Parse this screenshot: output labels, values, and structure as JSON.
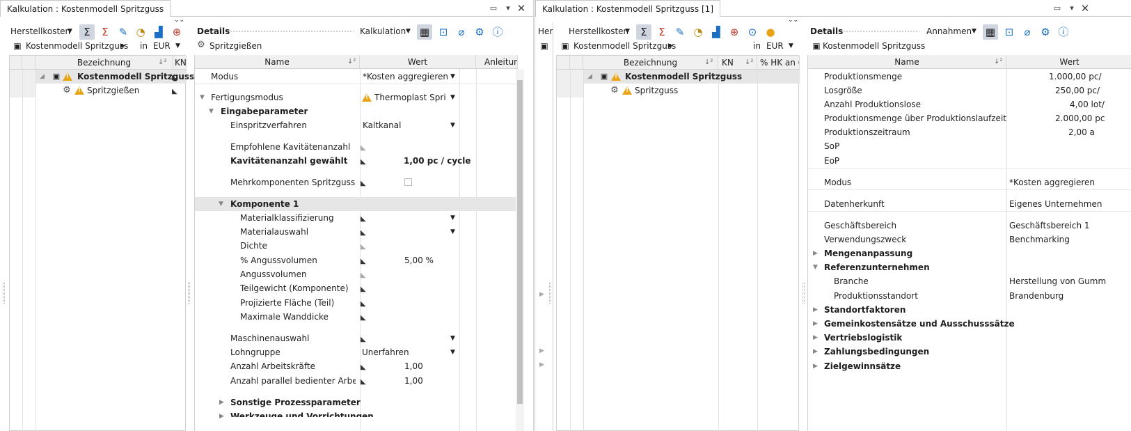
{
  "left_window": {
    "title": "Kalkulation : Kostenmodell Spritzguss",
    "toolbar": {
      "cost_select": "Herstellkosten",
      "breadcrumb": "Kostenmodell Spritzguss",
      "in_label": "in",
      "currency": "EUR"
    },
    "tree": {
      "columns": [
        "Bezeichnung",
        "KN"
      ],
      "rows": [
        {
          "label": "Kostenmodell Spritzguss"
        },
        {
          "label": "Spritzgießen"
        }
      ]
    },
    "details": {
      "title": "Details",
      "mode": "Kalkulation",
      "subtitle": "Spritzgießen",
      "columns": {
        "name": "Name",
        "value": "Wert",
        "guide": "Anleitung"
      },
      "rows": [
        {
          "name": "Modus",
          "value": "*Kosten aggregieren"
        },
        {
          "name": "Fertigungsmodus",
          "value": "Thermoplast Sprit..."
        },
        {
          "name": "Eingabeparameter",
          "value": ""
        },
        {
          "name": "Einspritzverfahren",
          "value": "Kaltkanal"
        },
        {
          "name": "Empfohlene Kavitätenanzahl",
          "value": ""
        },
        {
          "name": "Kavitätenanzahl gewählt",
          "value": "1,00 pc / cycle"
        },
        {
          "name": "Mehrkomponenten Spritzguss",
          "value": ""
        },
        {
          "name": "Komponente 1",
          "value": ""
        },
        {
          "name": "Materialklassifizierung",
          "value": ""
        },
        {
          "name": "Materialauswahl",
          "value": ""
        },
        {
          "name": "Dichte",
          "value": ""
        },
        {
          "name": "% Angussvolumen",
          "value": "5,00 %"
        },
        {
          "name": "Angussvolumen",
          "value": ""
        },
        {
          "name": "Teilgewicht (Komponente)",
          "value": ""
        },
        {
          "name": "Projizierte Fläche (Teil)",
          "value": ""
        },
        {
          "name": "Maximale Wanddicke",
          "value": ""
        },
        {
          "name": "Maschinenauswahl",
          "value": ""
        },
        {
          "name": "Lohngruppe",
          "value": "Unerfahren"
        },
        {
          "name": "Anzahl Arbeitskräfte",
          "value": "1,00"
        },
        {
          "name": "Anzahl parallel bedienter Arbeits...",
          "value": "1,00"
        },
        {
          "name": "Sonstige Prozessparameter",
          "value": ""
        },
        {
          "name": "Werkzeuge und Vorrichtungen",
          "value": ""
        }
      ]
    }
  },
  "right_window": {
    "title": "Kalkulation : Kostenmodell Spritzguss [1]",
    "toolbar": {
      "cut_label": "Her",
      "cost_select": "Herstellkosten",
      "breadcrumb": "Kostenmodell Spritzguss",
      "in_label": "in",
      "currency": "EUR"
    },
    "tree": {
      "columns": [
        "Bezeichnung",
        "KN",
        "% HK an G"
      ],
      "rows": [
        {
          "label": "Kostenmodell Spritzguss"
        },
        {
          "label": "Spritzguss"
        }
      ]
    },
    "details": {
      "title": "Details",
      "mode": "Annahmen",
      "subtitle": "Kostenmodell Spritzguss",
      "columns": {
        "name": "Name",
        "value": "Wert"
      },
      "rows": [
        {
          "name": "Produktionsmenge",
          "value": "1.000,00 pc/"
        },
        {
          "name": "Losgröße",
          "value": "250,00 pc/"
        },
        {
          "name": "Anzahl Produktionslose",
          "value": "4,00 lot/"
        },
        {
          "name": "Produktionsmenge über Produktionslaufzeit",
          "value": "2.000,00 pc"
        },
        {
          "name": "Produktionszeitraum",
          "value": "2,00 a"
        },
        {
          "name": "SoP",
          "value": ""
        },
        {
          "name": "EoP",
          "value": ""
        },
        {
          "name": "Modus",
          "value": "*Kosten aggregieren"
        },
        {
          "name": "Datenherkunft",
          "value": "Eigenes Unternehmen"
        },
        {
          "name": "Geschäftsbereich",
          "value": "Geschäftsbereich 1"
        },
        {
          "name": "Verwendungszweck",
          "value": "Benchmarking"
        },
        {
          "name": "Mengenanpassung",
          "value": ""
        },
        {
          "name": "Referenzunternehmen",
          "value": ""
        },
        {
          "name": "Branche",
          "value": "Herstellung von Gumm"
        },
        {
          "name": "Produktionsstandort",
          "value": "Brandenburg"
        },
        {
          "name": "Standortfaktoren",
          "value": ""
        },
        {
          "name": "Gemeinkostensätze und Ausschusssätze",
          "value": ""
        },
        {
          "name": "Vertriebslogistik",
          "value": ""
        },
        {
          "name": "Zahlungsbedingungen",
          "value": ""
        },
        {
          "name": "Zielgewinnsätze",
          "value": ""
        }
      ]
    }
  },
  "colors": {
    "border": "#c8c8c8",
    "header_bg": "#f0f0f0",
    "selected_row": "#e6e6e6",
    "warning": "#e8a317",
    "icon_blue": "#1a6fc4",
    "icon_red": "#c0392b"
  }
}
